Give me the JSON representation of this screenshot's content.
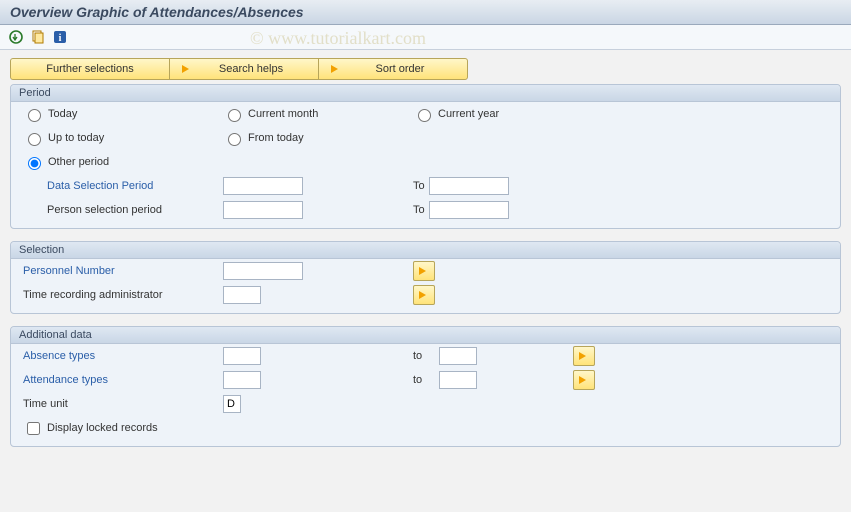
{
  "title": "Overview Graphic of Attendances/Absences",
  "watermark": "© www.tutorialkart.com",
  "toolbar": {
    "execute_icon": "execute",
    "variant_icon": "variant",
    "info_icon": "info"
  },
  "buttons": {
    "further_selections": "Further selections",
    "search_helps": "Search helps",
    "sort_order": "Sort order"
  },
  "period": {
    "title": "Period",
    "today": "Today",
    "current_month": "Current month",
    "current_year": "Current year",
    "up_to_today": "Up to today",
    "from_today": "From today",
    "other_period": "Other period",
    "selected": "other_period",
    "data_selection_label": "Data Selection Period",
    "person_selection_label": "Person selection period",
    "to_label": "To",
    "data_from": "",
    "data_to": "",
    "person_from": "",
    "person_to": ""
  },
  "selection": {
    "title": "Selection",
    "personnel_number_label": "Personnel Number",
    "personnel_number_value": "",
    "time_admin_label": "Time recording administrator",
    "time_admin_value": ""
  },
  "additional": {
    "title": "Additional data",
    "absence_types_label": "Absence types",
    "absence_types_from": "",
    "absence_types_to": "",
    "attendance_types_label": "Attendance types",
    "attendance_types_from": "",
    "attendance_types_to": "",
    "time_unit_label": "Time unit",
    "time_unit_value": "D",
    "display_locked_label": "Display locked records",
    "display_locked_checked": false,
    "to_label": "to"
  }
}
